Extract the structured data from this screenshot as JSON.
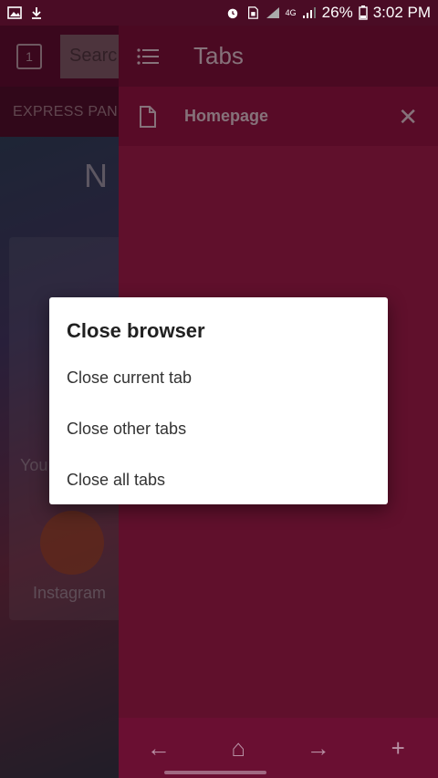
{
  "status_bar": {
    "battery": "26%",
    "time": "3:02 PM",
    "network": "4G"
  },
  "background": {
    "tab_count": "1",
    "search_placeholder": "Searc",
    "express_panel": "EXPRESS PANE",
    "page_title": "N",
    "you_label": "You",
    "instagram_label": "Instagram"
  },
  "drawer": {
    "title": "Tabs",
    "tabs": [
      {
        "label": "Homepage"
      }
    ]
  },
  "dialog": {
    "title": "Close browser",
    "options": [
      {
        "label": "Close current tab"
      },
      {
        "label": "Close other tabs"
      },
      {
        "label": "Close all tabs"
      }
    ]
  },
  "colors": {
    "status_bar": "#4a0c25",
    "drawer": "#9c1a47",
    "drawer_header": "#7a0f38",
    "bottom_nav": "#6a0f32",
    "dialog": "#ffffff"
  },
  "icons": [
    "image-icon",
    "download-icon",
    "alarm-icon",
    "sim-icon",
    "signal-icon",
    "battery-icon",
    "menu-list-icon",
    "document-icon",
    "close-icon",
    "back-arrow-icon",
    "home-icon",
    "forward-arrow-icon",
    "plus-icon"
  ]
}
